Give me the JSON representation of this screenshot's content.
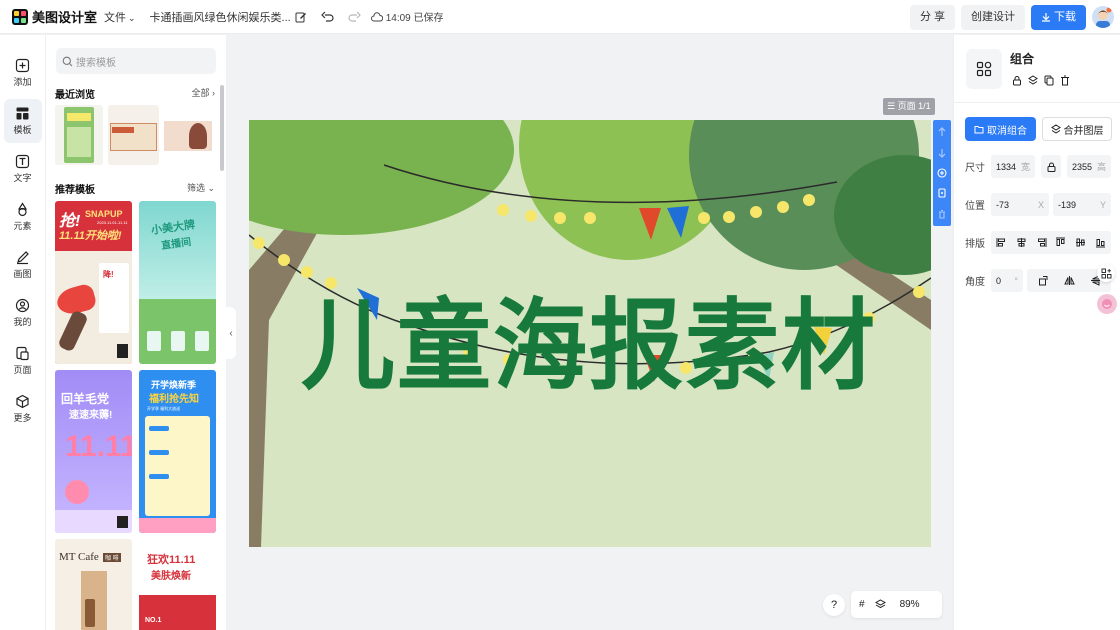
{
  "app": {
    "name": "美图设计室",
    "file_menu": "文件",
    "doc_title": "卡通插画风绿色休闲娱乐类...",
    "save_time": "14:09 已保存"
  },
  "top_actions": {
    "share": "分 享",
    "create": "创建设计",
    "download": "下载"
  },
  "rail": [
    {
      "label": "添加",
      "icon": "plus-square-icon"
    },
    {
      "label": "模板",
      "icon": "template-icon",
      "active": true
    },
    {
      "label": "文字",
      "icon": "text-icon"
    },
    {
      "label": "元素",
      "icon": "shapes-icon"
    },
    {
      "label": "画图",
      "icon": "pen-icon"
    },
    {
      "label": "我的",
      "icon": "user-icon"
    },
    {
      "label": "页面",
      "icon": "pages-icon"
    },
    {
      "label": "更多",
      "icon": "cube-icon"
    }
  ],
  "panel": {
    "search_placeholder": "搜索模板",
    "recent_title": "最近浏览",
    "recent_more": "全部",
    "recommend_title": "推荐模板",
    "recommend_filter": "筛选"
  },
  "templates": {
    "t1": {
      "line1": "抢!",
      "line2": "SNAPUP",
      "line3": "11.11开始啦!",
      "badge": "降!",
      "date": "2023.11.01-11.11"
    },
    "t2": {
      "line1": "小美大牌",
      "line2": "直播间"
    },
    "t3": {
      "line1": "回羊毛党",
      "line2": "速速来薅!",
      "line3": "11.11"
    },
    "t4": {
      "line1": "开学焕新季",
      "line2": "福利抢先知",
      "line3": "开学季 福利大放送"
    },
    "t5": {
      "line1": "MT Cafe",
      "line2": "咖 啡"
    },
    "t6": {
      "line1": "狂欢11.11",
      "line2": "美肤焕新",
      "line3": "NO.1"
    }
  },
  "canvas": {
    "page_tag": "页面 1/1",
    "headline": "儿童海报素材",
    "zoom": "89%"
  },
  "props": {
    "title": "组合",
    "ungroup": "取消组合",
    "merge": "合并图层",
    "size_label": "尺寸",
    "width": "1334",
    "width_unit": "宽",
    "height": "2355",
    "height_unit": "高",
    "pos_label": "位置",
    "x": "-73",
    "x_unit": "X",
    "y": "-139",
    "y_unit": "Y",
    "align_label": "排版",
    "angle_label": "角度",
    "angle": "0",
    "angle_unit": "°"
  },
  "colors": {
    "accent": "#2b7bf6",
    "headline_green": "#177a3c",
    "canvas_bg": "#d7e5c2"
  }
}
